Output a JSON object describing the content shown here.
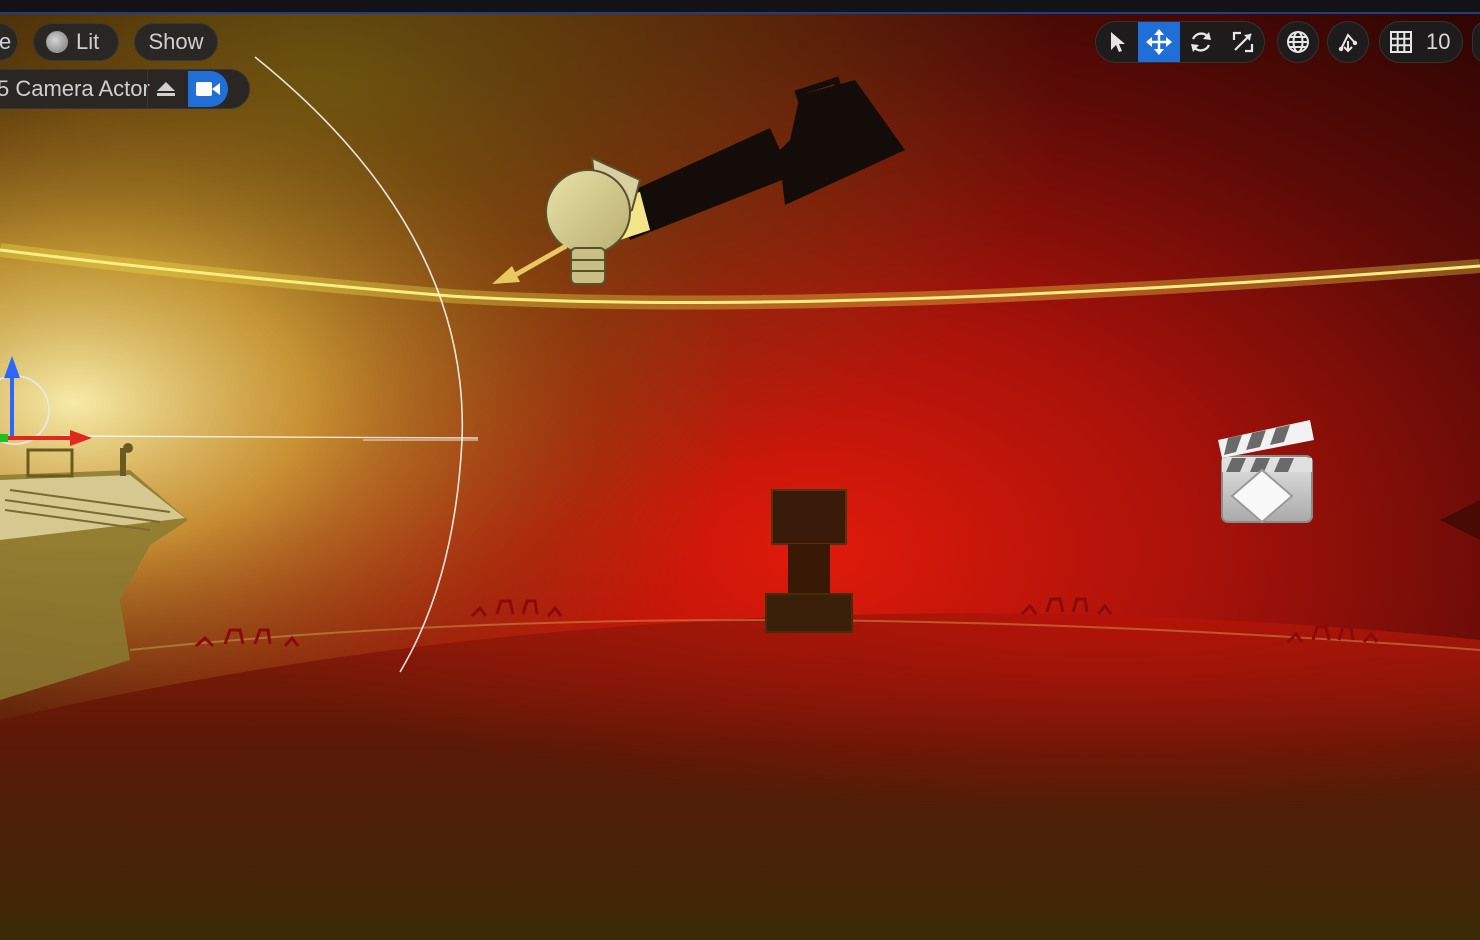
{
  "toolbar": {
    "mode_partial": "e",
    "view_mode_label": "Lit",
    "show_label": "Show",
    "pilot_label": "5 Camera Actor",
    "grid_value": "10"
  },
  "icons": {
    "view_mode": "lit-sphere-icon",
    "eject": "eject-icon",
    "camera": "video-camera-icon",
    "select": "cursor-arrow-icon",
    "translate": "move-arrows-icon",
    "rotate": "rotate-icon",
    "scale": "scale-icon",
    "world": "globe-icon",
    "surface_snap": "surface-snap-icon",
    "grid": "grid-icon"
  },
  "colors": {
    "accent_blue": "#1f6fd6",
    "pill_bg": "#2a2624",
    "stage_red": "#d81010",
    "light_yellow": "#f4e34a"
  }
}
